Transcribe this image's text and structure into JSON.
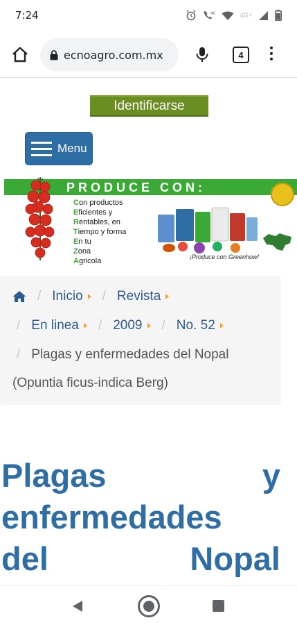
{
  "status_bar": {
    "time": "7:24",
    "network_label": "4G+",
    "icons": [
      "alarm-icon",
      "volte-icon",
      "wifi-icon",
      "signal-icon",
      "battery-icon"
    ]
  },
  "browser": {
    "url": "ecnoagro.com.mx",
    "tab_count": "4",
    "icons": [
      "home-icon",
      "lock-icon",
      "mic-icon",
      "tabs-icon",
      "more-menu-icon"
    ]
  },
  "header": {
    "login_label": "Identificarse",
    "menu_label": "Menu"
  },
  "banner": {
    "title": "PRODUCE CON:",
    "lines": [
      {
        "initial": "C",
        "rest": "on productos"
      },
      {
        "initial": "E",
        "rest": "ficientes y"
      },
      {
        "initial": "R",
        "rest": "entables, en"
      },
      {
        "initial": "T",
        "rest": "iempo y forma"
      },
      {
        "initial": "E",
        "rest": "n tu"
      },
      {
        "initial": "Z",
        "rest": "ona"
      },
      {
        "initial": "A",
        "rest": "gricola"
      }
    ],
    "slogan": "¡Produce con Greenhow!"
  },
  "breadcrumb": {
    "items": [
      "Inicio",
      "Revista",
      "En linea",
      "2009",
      "No. 52"
    ],
    "current_line1": "Plagas y enfermedades del Nopal",
    "current_line2": "(Opuntia ficus-indica Berg)"
  },
  "article": {
    "title_lines": [
      "Plagas y",
      "enfermedades",
      "del Nopal"
    ]
  },
  "colors": {
    "link": "#2c5c8f",
    "headline": "#2f6ea5",
    "login_bg": "#6b8e23",
    "menu_bg": "#2f6ea5",
    "caret": "#f0a33a",
    "banner_green": "#3aa935"
  }
}
